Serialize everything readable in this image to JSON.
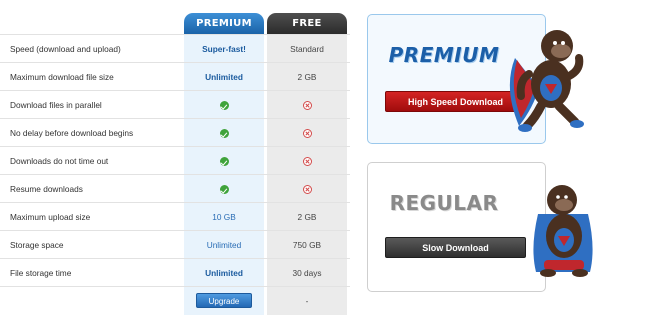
{
  "table": {
    "header_premium": "PREMIUM",
    "header_free": "FREE",
    "rows": [
      {
        "label": "Speed (download and upload)",
        "premium": "Super-fast!",
        "free": "Standard"
      },
      {
        "label": "Maximum download file size",
        "premium": "Unlimited",
        "free": "2 GB"
      },
      {
        "label": "Download files in parallel",
        "premium": "check-icon",
        "free": "cross-icon"
      },
      {
        "label": "No delay before download begins",
        "premium": "check-icon",
        "free": "cross-icon"
      },
      {
        "label": "Downloads do not time out",
        "premium": "check-icon",
        "free": "cross-icon"
      },
      {
        "label": "Resume downloads",
        "premium": "check-icon",
        "free": "cross-icon"
      },
      {
        "label": "Maximum upload size",
        "premium": "10 GB",
        "free": "2 GB"
      },
      {
        "label": "Storage space",
        "premium": "Unlimited",
        "free": "750 GB"
      },
      {
        "label": "File storage time",
        "premium": "Unlimited",
        "free": "30 days"
      }
    ],
    "upgrade_label": "Upgrade",
    "free_last": "-"
  },
  "panels": {
    "premium": {
      "title": "PREMIUM",
      "button": "High Speed Download"
    },
    "regular": {
      "title": "REGULAR",
      "button": "Slow Download"
    }
  },
  "colors": {
    "premium_blue": "#1c5fa8",
    "free_dark": "#2b2b2b",
    "download_red": "#c21a1a",
    "check_green": "#3fa33b",
    "cross_red": "#d34b4b"
  }
}
